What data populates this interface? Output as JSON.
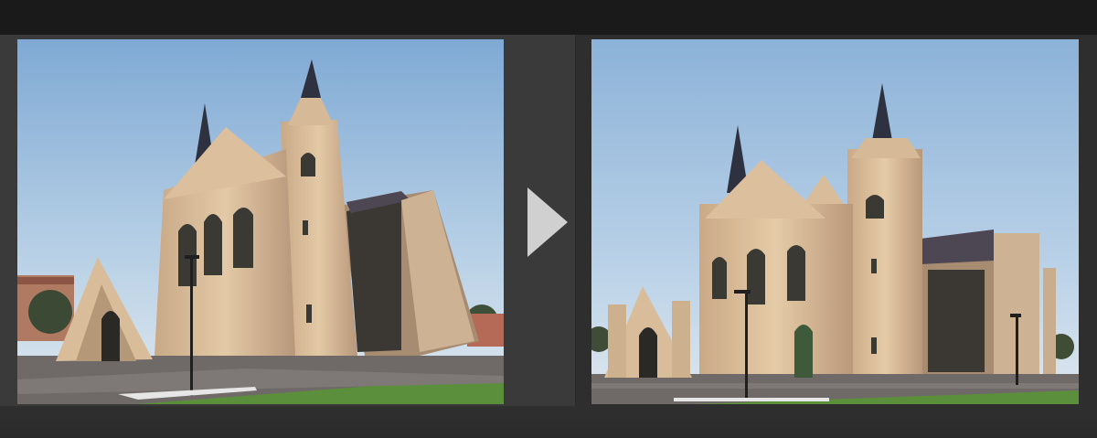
{
  "viewer": {
    "background_color": "#1b1b1b",
    "panel_left_color": "#3a3a3a",
    "panel_right_color": "#2e2e2e",
    "arrow_color": "#d0d0d0"
  },
  "images": [
    {
      "role": "before",
      "subject": "cathedral"
    },
    {
      "role": "after",
      "subject": "cathedral"
    }
  ],
  "controls": {
    "compare_arrow_icon": "play-right-triangle"
  }
}
